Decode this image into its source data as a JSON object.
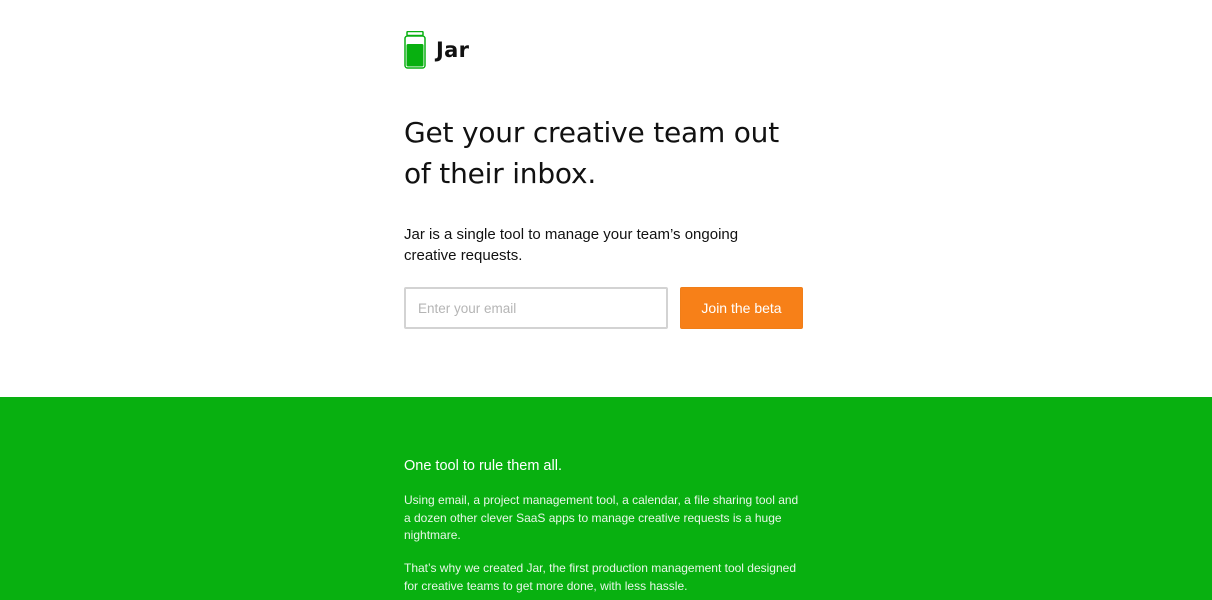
{
  "brand": {
    "name": "Jar",
    "logo_icon": "jar-icon",
    "accent_color": "#08b010"
  },
  "hero": {
    "headline": "Get your creative team out of their inbox.",
    "subhead": "Jar is a single tool to manage your team’s ongoing creative requests.",
    "email_placeholder": "Enter your email",
    "email_value": "",
    "cta_label": "Join the beta",
    "cta_color": "#f78018"
  },
  "features": {
    "background_color": "#08b010",
    "heading": "One tool to rule them all.",
    "paragraph_1": "Using email, a project management tool, a calendar, a file sharing tool and a dozen other clever SaaS apps to manage creative requests is a huge nightmare.",
    "paragraph_2": "That’s why we created Jar, the first production management tool designed for creative teams to get more done, with less hassle."
  }
}
